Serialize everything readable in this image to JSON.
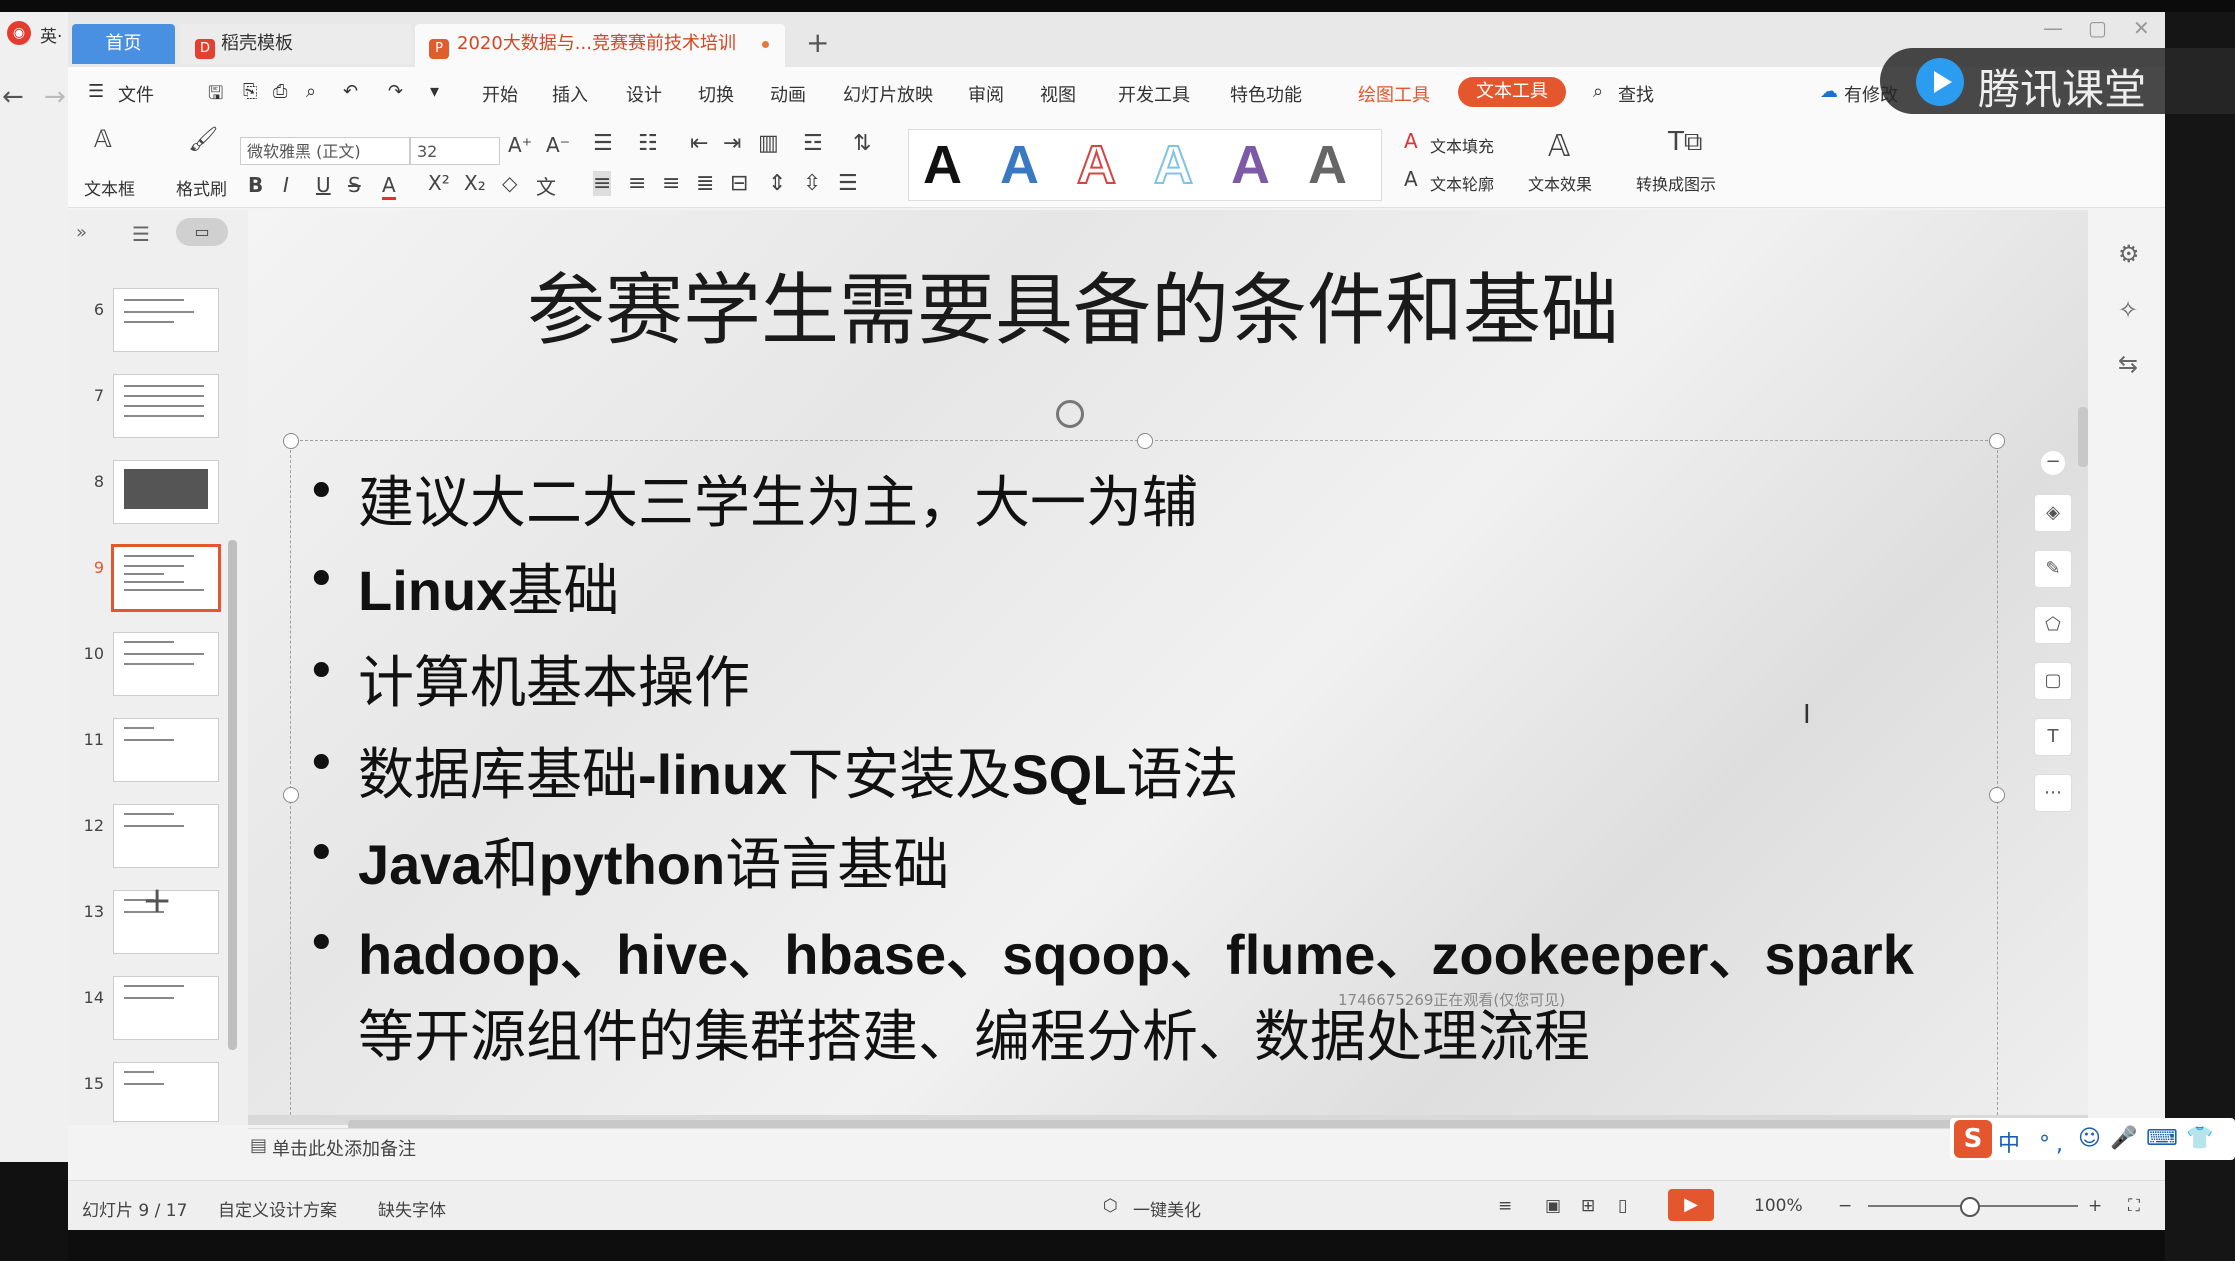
{
  "outer": {
    "left_label": "英·"
  },
  "tabs": {
    "home": "首页",
    "templates": "稻壳模板",
    "document": "2020大数据与...竞赛赛前技术培训",
    "new_tab": "+"
  },
  "menu": {
    "file": "文件",
    "items": [
      "开始",
      "插入",
      "设计",
      "切换",
      "动画",
      "幻灯片放映",
      "审阅",
      "视图",
      "开发工具",
      "特色功能"
    ],
    "drawing_tools": "绘图工具",
    "text_tools": "文本工具",
    "find": "查找",
    "modified": "有修改"
  },
  "ribbon": {
    "textbox": "文本框",
    "format_painter": "格式刷",
    "font_name": "微软雅黑 (正文)",
    "font_size": "32",
    "style_letter": "A",
    "text_fill": "文本填充",
    "text_outline": "文本轮廓",
    "text_effect": "文本效果",
    "convert_to_graphic": "转换成图示"
  },
  "thumbnails": {
    "numbers": [
      "6",
      "7",
      "8",
      "9",
      "10",
      "11",
      "12",
      "13",
      "14",
      "15"
    ],
    "selected": "9"
  },
  "slide": {
    "title": "参赛学生需要具备的条件和基础",
    "bullets": [
      "建议大二大三学生为主，大一为辅",
      "Linux基础",
      "计算机基本操作",
      "数据库基础-linux下安装及SQL语法",
      "Java和python语言基础",
      "hadoop、hive、hbase、sqoop、flume、zookeeper、spark",
      "等开源组件的集群搭建、编程分析、数据处理流程"
    ],
    "bullet_rich": {
      "b2_bold": "Linux",
      "b2_rest": "基础",
      "b4_a": "数据库基础",
      "b4_b": "-linux",
      "b4_c": "下安装及",
      "b4_d": "SQL",
      "b4_e": "语法",
      "b5_a": "Java",
      "b5_b": "和",
      "b5_c": "python",
      "b5_d": "语言基础"
    },
    "watermark": "1746675269正在观看(仅您可见)"
  },
  "notes": {
    "placeholder": "单击此处添加备注"
  },
  "status": {
    "slide_counter": "幻灯片 9 / 17",
    "design": "自定义设计方案",
    "missing_font": "缺失字体",
    "beautify": "一键美化",
    "zoom": "100%"
  },
  "overlay": {
    "tencent": "腾讯课堂",
    "ime": "中 °,"
  },
  "colors": {
    "accent": "#e4572e",
    "home_tab": "#4a90e2",
    "gallery": [
      "#111111",
      "#3a78c3",
      "#d64541",
      "#7fc4e8",
      "#7d5aa8",
      "#666666"
    ]
  }
}
